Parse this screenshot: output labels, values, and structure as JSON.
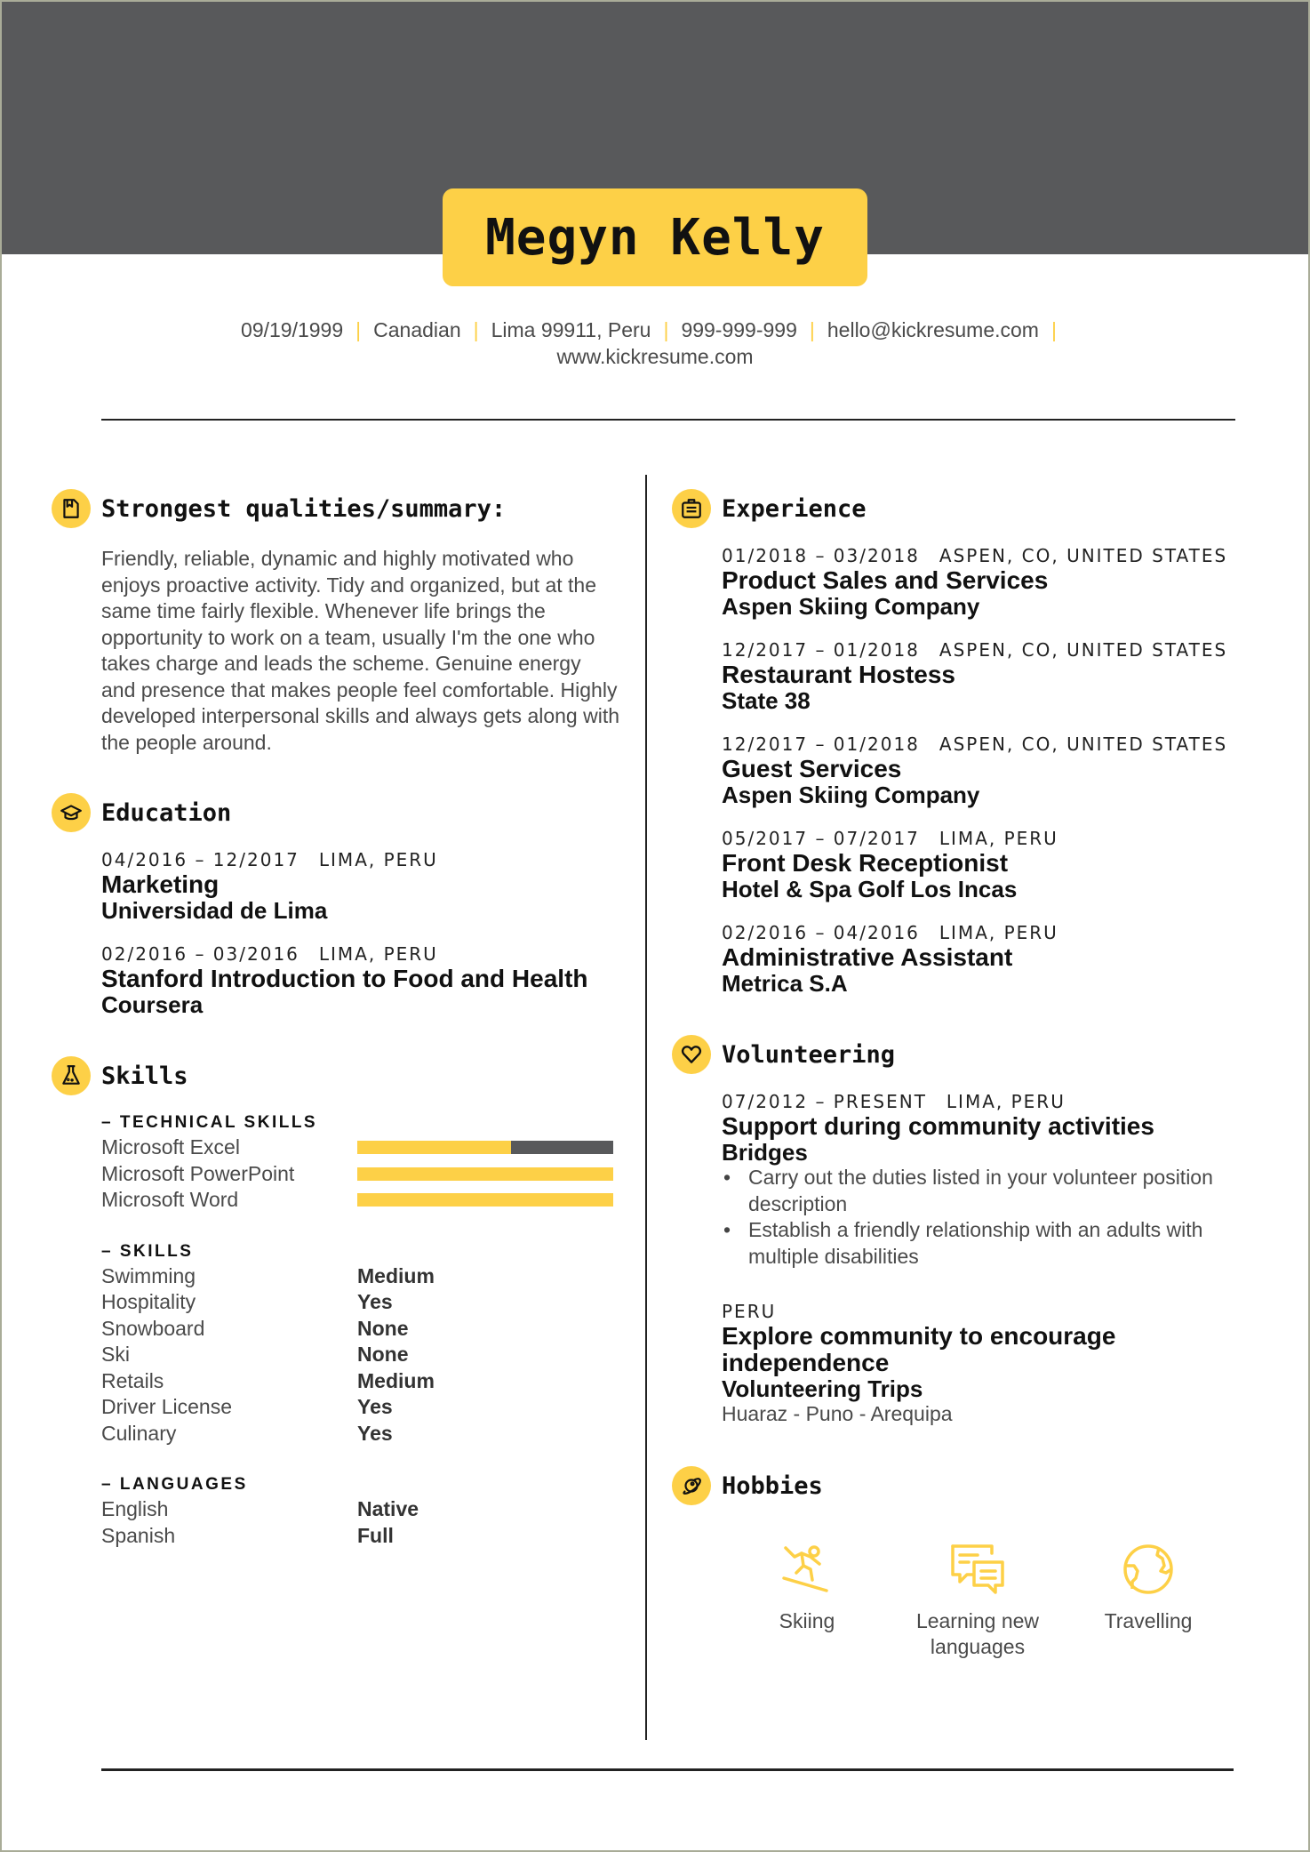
{
  "colors": {
    "accent": "#fdd047",
    "band": "#58595b",
    "text": "#4a4a4a",
    "heading": "#111111"
  },
  "header": {
    "name": "Megyn Kelly",
    "contact": [
      "09/19/1999",
      "Canadian",
      "Lima 99911, Peru",
      "999-999-999",
      "hello@kickresume.com"
    ],
    "website": "www.kickresume.com"
  },
  "summary": {
    "title": "Strongest qualities/summary:",
    "icon": "bookmark-icon",
    "text": "Friendly, reliable, dynamic and highly motivated who enjoys proactive activity. Tidy and organized, but at the same time fairly flexible.  Whenever life brings the opportunity to work on a team, usually I'm the one who takes charge and leads the scheme. Genuine energy and presence that makes people feel comfortable. Highly developed interpersonal skills and always gets along with the people around."
  },
  "education": {
    "title": "Education",
    "icon": "graduation-cap-icon",
    "items": [
      {
        "dates": "04/2016 – 12/2017",
        "location": "LIMA, PERU",
        "title": "Marketing",
        "org": "Universidad de Lima"
      },
      {
        "dates": "02/2016 – 03/2016",
        "location": "LIMA, PERU",
        "title": "Stanford Introduction to Food and Health",
        "org": "Coursera"
      }
    ]
  },
  "skills": {
    "title": "Skills",
    "icon": "flask-icon",
    "technical_label": "– TECHNICAL SKILLS",
    "technical": [
      {
        "name": "Microsoft Excel",
        "level": 0.6
      },
      {
        "name": "Microsoft PowerPoint",
        "level": 1.0
      },
      {
        "name": "Microsoft Word",
        "level": 1.0
      }
    ],
    "skills_label": "– SKILLS",
    "skills": [
      {
        "name": "Swimming",
        "level": "Medium"
      },
      {
        "name": "Hospitality",
        "level": "Yes"
      },
      {
        "name": "Snowboard",
        "level": "None"
      },
      {
        "name": "Ski",
        "level": "None"
      },
      {
        "name": "Retails",
        "level": "Medium"
      },
      {
        "name": "Driver License",
        "level": "Yes"
      },
      {
        "name": "Culinary",
        "level": "Yes"
      }
    ],
    "languages_label": "– LANGUAGES",
    "languages": [
      {
        "name": "English",
        "level": "Native"
      },
      {
        "name": "Spanish",
        "level": "Full"
      }
    ]
  },
  "experience": {
    "title": "Experience",
    "icon": "briefcase-icon",
    "items": [
      {
        "dates": "01/2018 – 03/2018",
        "location": "ASPEN, CO, UNITED STATES",
        "title": "Product Sales and Services",
        "org": "Aspen Skiing Company"
      },
      {
        "dates": "12/2017 – 01/2018",
        "location": "ASPEN, CO, UNITED STATES",
        "title": "Restaurant Hostess",
        "org": "State 38"
      },
      {
        "dates": "12/2017 – 01/2018",
        "location": "ASPEN, CO, UNITED STATES",
        "title": "Guest Services",
        "org": "Aspen Skiing Company"
      },
      {
        "dates": "05/2017 – 07/2017",
        "location": "LIMA, PERU",
        "title": "Front Desk Receptionist",
        "org": "Hotel & Spa Golf Los Incas"
      },
      {
        "dates": "02/2016 – 04/2016",
        "location": "LIMA, PERU",
        "title": "Administrative Assistant",
        "org": "Metrica S.A"
      }
    ]
  },
  "volunteering": {
    "title": "Volunteering",
    "icon": "heart-icon",
    "items": [
      {
        "dates": "07/2012 – PRESENT",
        "location": "LIMA, PERU",
        "title": "Support during community activities",
        "org": "Bridges",
        "bullets": [
          "Carry out the duties listed in your volunteer position description",
          "Establish a friendly relationship with an adults with multiple disabilities"
        ]
      },
      {
        "dates": "",
        "location": "PERU",
        "title": "Explore community to encourage independence",
        "org": "Volunteering Trips",
        "note": "Huaraz - Puno - Arequipa"
      }
    ]
  },
  "hobbies": {
    "title": "Hobbies",
    "icon": "planet-icon",
    "items": [
      {
        "label": "Skiing",
        "icon": "snowboarder-icon"
      },
      {
        "label": "Learning new languages",
        "icon": "chat-bubbles-icon"
      },
      {
        "label": "Travelling",
        "icon": "globe-icon"
      }
    ]
  }
}
